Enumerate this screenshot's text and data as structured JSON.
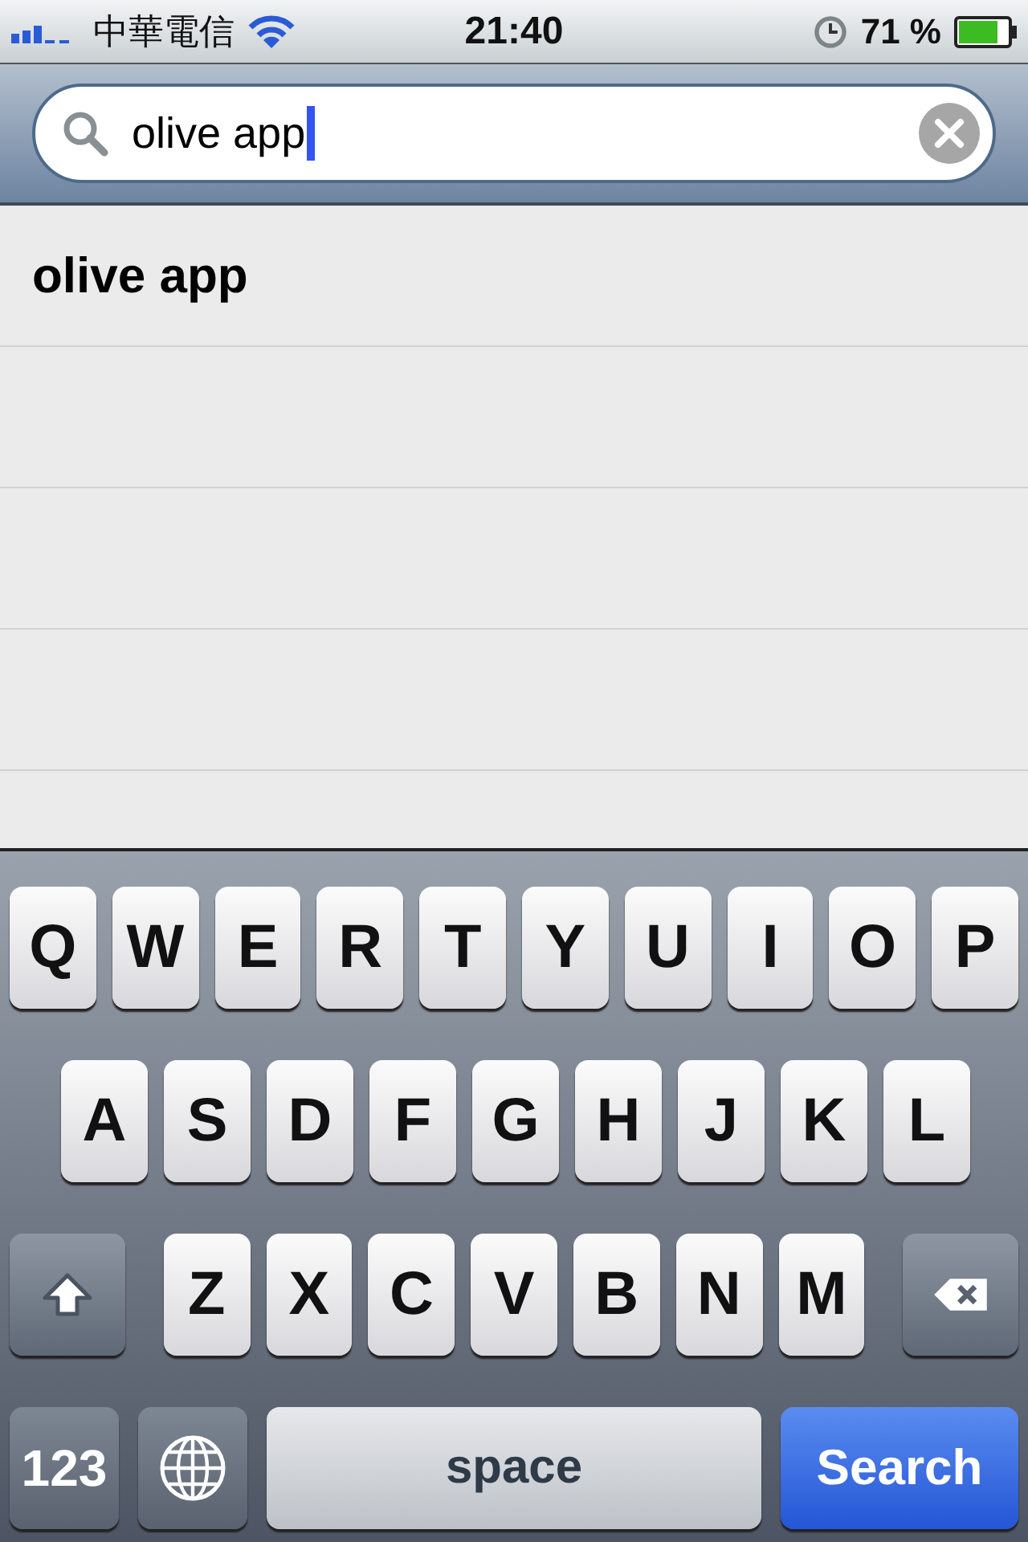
{
  "status_bar": {
    "carrier": "中華電信",
    "time": "21:40",
    "battery": "71 %"
  },
  "search": {
    "value": "olive app"
  },
  "suggestions": [
    {
      "text": "olive app"
    }
  ],
  "keyboard": {
    "letter_rows": [
      [
        {
          "kind": "letter",
          "label": "Q"
        },
        {
          "kind": "letter",
          "label": "W"
        },
        {
          "kind": "letter",
          "label": "E"
        },
        {
          "kind": "letter",
          "label": "R"
        },
        {
          "kind": "letter",
          "label": "T"
        },
        {
          "kind": "letter",
          "label": "Y"
        },
        {
          "kind": "letter",
          "label": "U"
        },
        {
          "kind": "letter",
          "label": "I"
        },
        {
          "kind": "letter",
          "label": "O"
        },
        {
          "kind": "letter",
          "label": "P"
        }
      ],
      [
        {
          "kind": "letter",
          "label": "A"
        },
        {
          "kind": "letter",
          "label": "S"
        },
        {
          "kind": "letter",
          "label": "D"
        },
        {
          "kind": "letter",
          "label": "F"
        },
        {
          "kind": "letter",
          "label": "G"
        },
        {
          "kind": "letter",
          "label": "H"
        },
        {
          "kind": "letter",
          "label": "J"
        },
        {
          "kind": "letter",
          "label": "K"
        },
        {
          "kind": "letter",
          "label": "L"
        }
      ],
      [
        {
          "kind": "shift"
        },
        {
          "kind": "letter",
          "label": "Z"
        },
        {
          "kind": "letter",
          "label": "X"
        },
        {
          "kind": "letter",
          "label": "C"
        },
        {
          "kind": "letter",
          "label": "V"
        },
        {
          "kind": "letter",
          "label": "B"
        },
        {
          "kind": "letter",
          "label": "N"
        },
        {
          "kind": "letter",
          "label": "M"
        },
        {
          "kind": "backspace"
        }
      ]
    ],
    "bottom_bar": {
      "numbers_key": "123",
      "space_key": "space",
      "action_key": "Search"
    }
  }
}
